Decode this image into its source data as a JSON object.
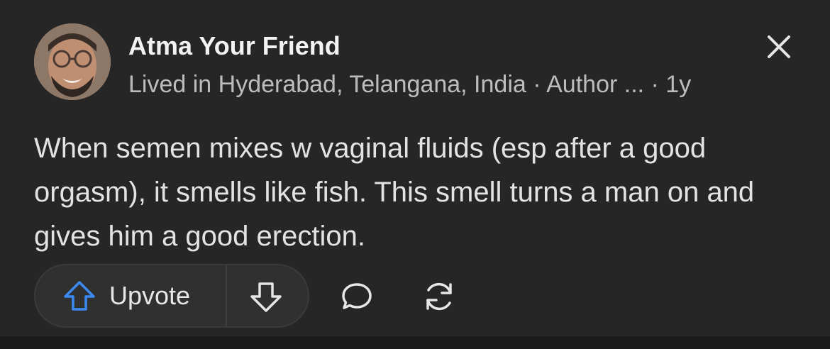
{
  "author": {
    "name": "Atma Your Friend",
    "credential": "Lived in Hyderabad, Telangana, India · Author ...  · 1y"
  },
  "post": {
    "text": "When semen mixes w vaginal fluids (esp after a good orgasm), it smells like fish. This smell turns a man on and gives him a good erection."
  },
  "actions": {
    "upvote_label": "Upvote"
  },
  "icons": {
    "close": "close-icon",
    "upvote": "arrow-up-icon",
    "downvote": "arrow-down-icon",
    "comment": "comment-bubble-icon",
    "share": "reshare-icon"
  },
  "colors": {
    "background": "#262626",
    "upvote_accent": "#3d8bf2",
    "text_primary": "#f2f2f2",
    "text_secondary": "#bdbdbd"
  }
}
